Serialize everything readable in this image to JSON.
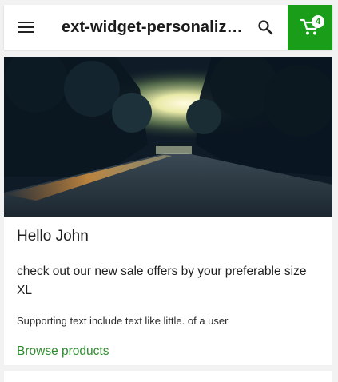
{
  "header": {
    "title": "ext-widget-personalization",
    "cart_count": "4",
    "icons": {
      "menu": "menu-icon",
      "search": "search-icon",
      "cart": "cart-icon"
    },
    "colors": {
      "cart_background": "#1a9e1a",
      "bar_background": "#ffffff"
    }
  },
  "card": {
    "title": "Hello John",
    "subtitle": "check out our new sale offers by your preferable size XL",
    "supporting_text": "Supporting text include text like little. of a user",
    "action_label": "Browse products",
    "action_color": "#2e8b2e"
  }
}
